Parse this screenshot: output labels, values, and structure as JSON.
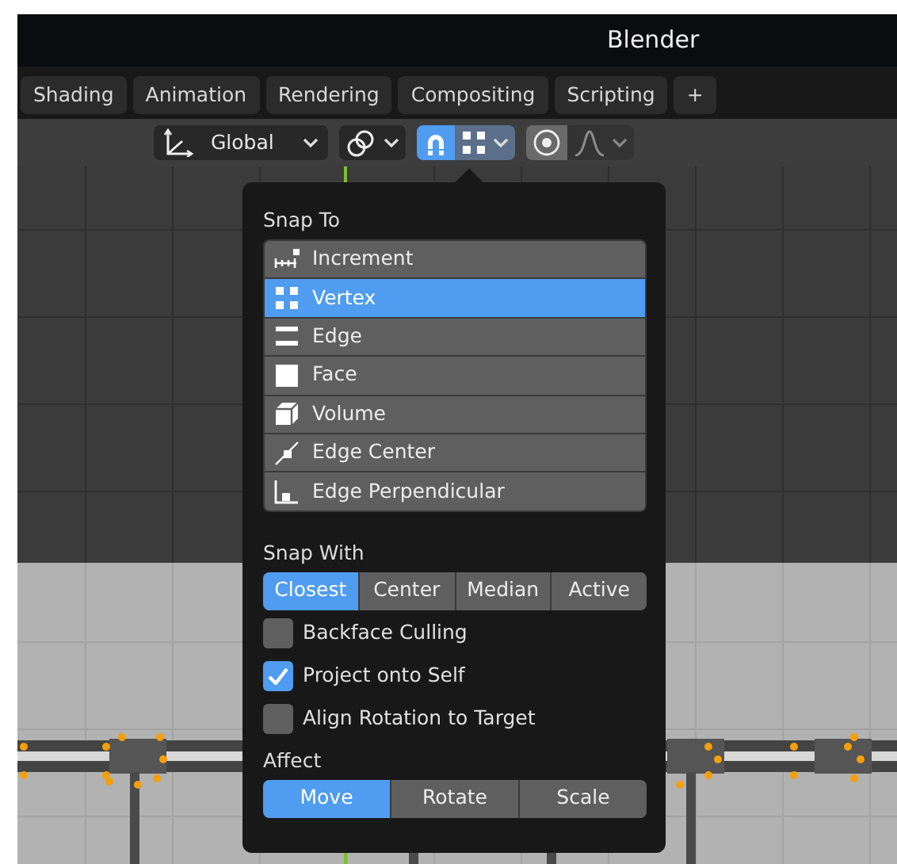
{
  "window": {
    "title": "Blender"
  },
  "workspace_tabs": [
    {
      "label": "Shading"
    },
    {
      "label": "Animation"
    },
    {
      "label": "Rendering"
    },
    {
      "label": "Compositing"
    },
    {
      "label": "Scripting"
    },
    {
      "label": "+"
    }
  ],
  "header": {
    "orientation": {
      "label": "Global"
    },
    "snap": {
      "on": true
    },
    "proportional_editing": {
      "on": false
    }
  },
  "snap_popup": {
    "snap_to": {
      "label": "Snap To",
      "options": [
        {
          "label": "Increment",
          "selected": false
        },
        {
          "label": "Vertex",
          "selected": true
        },
        {
          "label": "Edge",
          "selected": false
        },
        {
          "label": "Face",
          "selected": false
        },
        {
          "label": "Volume",
          "selected": false
        },
        {
          "label": "Edge Center",
          "selected": false
        },
        {
          "label": "Edge Perpendicular",
          "selected": false
        }
      ]
    },
    "snap_with": {
      "label": "Snap With",
      "options": [
        {
          "label": "Closest",
          "selected": true
        },
        {
          "label": "Center",
          "selected": false
        },
        {
          "label": "Median",
          "selected": false
        },
        {
          "label": "Active",
          "selected": false
        }
      ]
    },
    "checkboxes": [
      {
        "label": "Backface Culling",
        "checked": false
      },
      {
        "label": "Project onto Self",
        "checked": true
      },
      {
        "label": "Align Rotation to Target",
        "checked": false
      }
    ],
    "affect": {
      "label": "Affect",
      "options": [
        {
          "label": "Move",
          "selected": true
        },
        {
          "label": "Rotate",
          "selected": false
        },
        {
          "label": "Scale",
          "selected": false
        }
      ]
    }
  }
}
